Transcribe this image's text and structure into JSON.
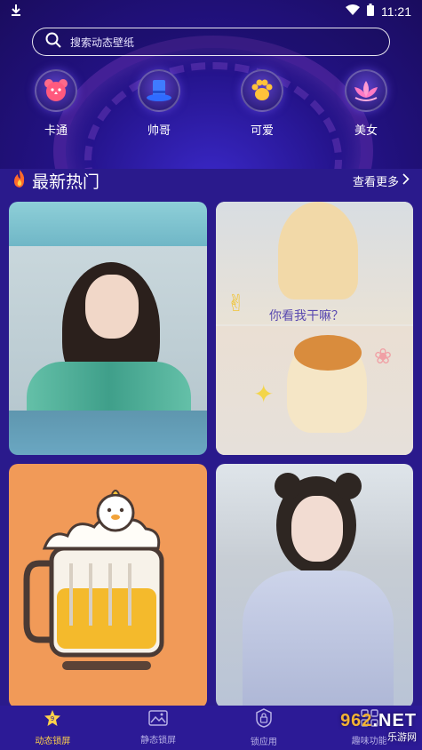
{
  "status_bar": {
    "time": "11:21"
  },
  "search": {
    "placeholder": "搜索动态壁纸"
  },
  "categories": [
    {
      "label": "卡通",
      "icon": "bear-icon"
    },
    {
      "label": "帅哥",
      "icon": "top-hat-icon"
    },
    {
      "label": "可爱",
      "icon": "paw-icon"
    },
    {
      "label": "美女",
      "icon": "lotus-icon"
    }
  ],
  "section": {
    "title": "最新热门",
    "more": "查看更多"
  },
  "cards": [
    {
      "name": "wallpaper-girl-hanfu"
    },
    {
      "name": "wallpaper-cat",
      "caption": "你看我干嘛？"
    },
    {
      "name": "wallpaper-beer-duck"
    },
    {
      "name": "wallpaper-girl-buns"
    }
  ],
  "tabs": [
    {
      "label": "动态锁屏",
      "active": true
    },
    {
      "label": "静态锁屏",
      "active": false
    },
    {
      "label": "锁应用",
      "active": false
    },
    {
      "label": "趣味功能",
      "active": false
    }
  ],
  "watermark": {
    "line1_a": "962",
    "line1_b": ".NET",
    "line2": "乐游网"
  },
  "colors": {
    "background": "#2a1a8c",
    "tab_active": "#ffd24a",
    "tab_inactive": "#b7b0e6"
  }
}
